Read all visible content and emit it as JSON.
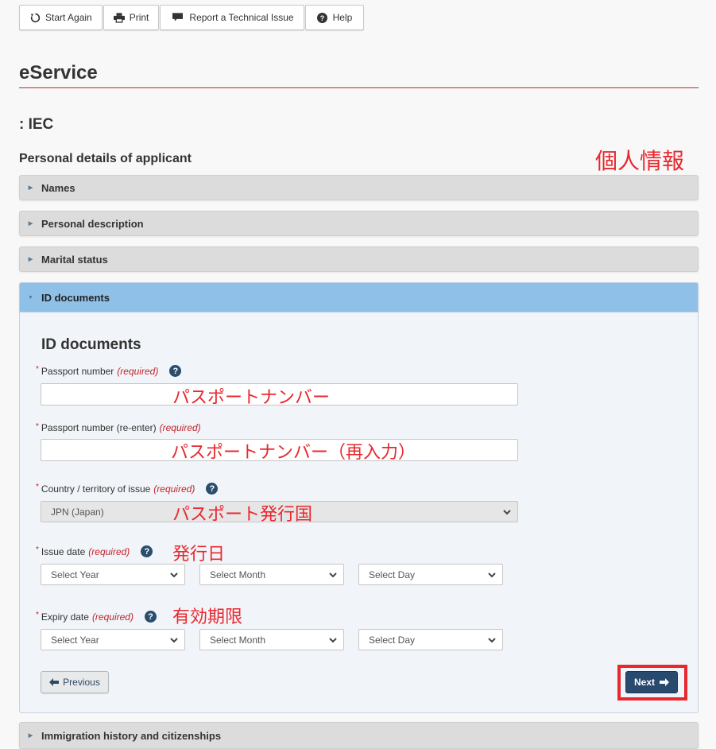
{
  "toolbar": {
    "buttons": [
      {
        "label": "Start Again",
        "icon": "refresh-icon"
      },
      {
        "label": "Print",
        "icon": "print-icon"
      },
      {
        "label": "Report a Technical Issue",
        "icon": "comment-icon"
      },
      {
        "label": "Help",
        "icon": "help-icon"
      }
    ]
  },
  "header": {
    "title": "eService",
    "subtitle": ": IEC",
    "section_heading": "Personal details of applicant"
  },
  "accordion": {
    "items": [
      {
        "label": "Names",
        "expanded": false
      },
      {
        "label": "Personal description",
        "expanded": false
      },
      {
        "label": "Marital status",
        "expanded": false
      },
      {
        "label": "ID documents",
        "expanded": true
      },
      {
        "label": "Immigration history and citizenships",
        "expanded": false
      }
    ]
  },
  "form": {
    "title": "ID documents",
    "required_marker": "*",
    "required_text": "(required)",
    "help_glyph": "?",
    "passport_number": {
      "label": "Passport number",
      "value": ""
    },
    "passport_number_reenter": {
      "label": "Passport number (re-enter)",
      "value": ""
    },
    "country": {
      "label": "Country / territory of issue",
      "selected": "JPN (Japan)",
      "disabled": true
    },
    "issue_date": {
      "label": "Issue date",
      "year": "Select Year",
      "month": "Select Month",
      "day": "Select Day"
    },
    "expiry_date": {
      "label": "Expiry date",
      "year": "Select Year",
      "month": "Select Month",
      "day": "Select Day"
    },
    "previous_label": "Previous",
    "next_label": "Next"
  },
  "annotations": {
    "personal_info": "個人情報",
    "passport_number": "パスポートナンバー",
    "passport_number_reenter": "パスポートナンバー（再入力）",
    "country": "パスポート発行国",
    "issue_date": "発行日",
    "expiry_date": "有効期限"
  },
  "colors": {
    "accent_red": "#c0262e",
    "annotation_red": "#e8282e",
    "active_header": "#8fc0e8",
    "primary_button": "#284a6e"
  }
}
